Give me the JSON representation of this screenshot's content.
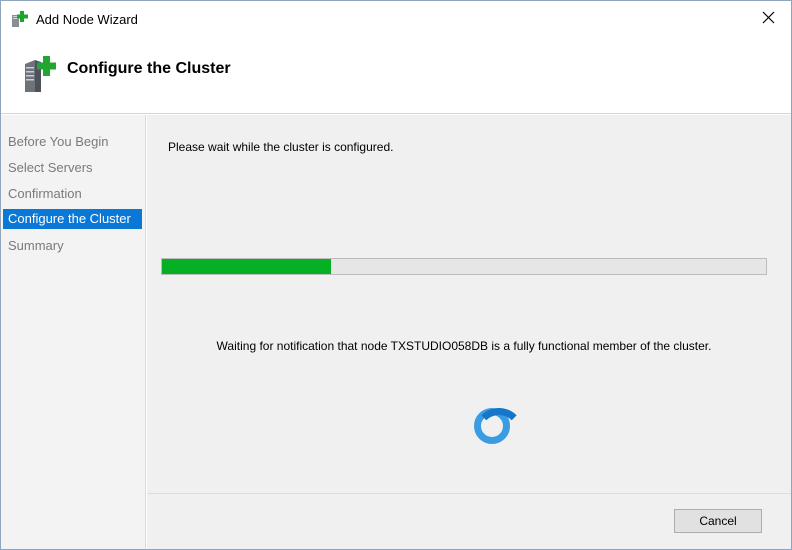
{
  "window": {
    "title": "Add Node Wizard",
    "title_icon": "cluster-node-add-icon",
    "close_icon": "close-icon"
  },
  "header": {
    "title": "Configure the Cluster",
    "icon": "server-add-icon"
  },
  "nav": {
    "items": [
      {
        "label": "Before You Begin",
        "active": false
      },
      {
        "label": "Select Servers",
        "active": false
      },
      {
        "label": "Confirmation",
        "active": false
      },
      {
        "label": "Configure the Cluster",
        "active": true
      },
      {
        "label": "Summary",
        "active": false
      }
    ]
  },
  "main": {
    "wait_message": "Please wait while the cluster is configured.",
    "progress_percent": 28,
    "status_message": "Waiting for notification that node TXSTUDIO058DB is a fully functional member of the cluster.",
    "spinner_icon": "busy-spinner-icon"
  },
  "footer": {
    "cancel_label": "Cancel"
  },
  "colors": {
    "progress_fill": "#06b025",
    "nav_active": "#0a78d7",
    "spinner": "#3a9de2"
  }
}
